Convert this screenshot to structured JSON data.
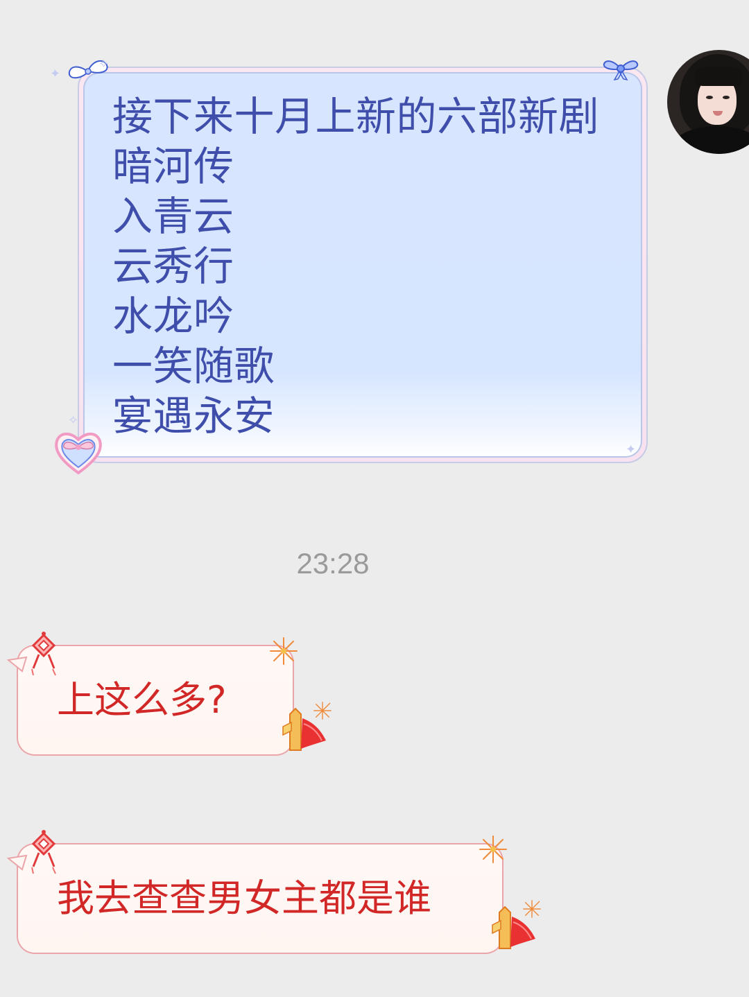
{
  "chat": {
    "outgoing_message": {
      "lines": [
        "接下来十月上新的六部新剧",
        "暗河传",
        "入青云",
        "云秀行",
        "水龙吟",
        "一笑随歌",
        "宴遇永安"
      ]
    },
    "timestamp": "23:28",
    "incoming_messages": [
      {
        "text": "上这么多?"
      },
      {
        "text": "我去查查男女主都是谁"
      }
    ]
  },
  "icons": {
    "avatar": "user-avatar",
    "bow": "bow-icon",
    "wings": "wings-icon",
    "heart": "heart-bow-icon",
    "knot": "chinese-knot-icon",
    "firework": "firework-icon",
    "tower": "festive-tower-icon"
  },
  "colors": {
    "background": "#ececec",
    "blue_text": "#3f4eab",
    "blue_bubble": "#d7e5fe",
    "red_text": "#d22727",
    "red_border": "#eba5aa",
    "timestamp": "#9a9a9a"
  }
}
